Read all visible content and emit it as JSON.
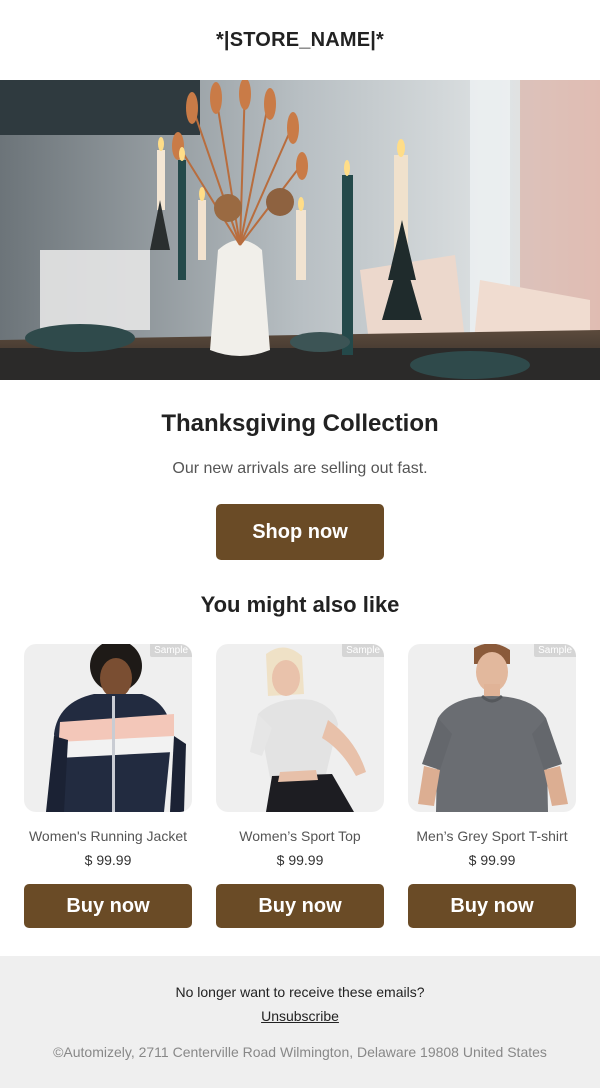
{
  "header": {
    "store_name": "*|STORE_NAME|*"
  },
  "hero": {
    "image": "thanksgiving-table-image",
    "title": "Thanksgiving Collection",
    "subtitle": "Our new arrivals are selling out fast.",
    "cta_label": "Shop now"
  },
  "recommendations": {
    "title": "You might also like",
    "sample_badge": "Sample",
    "buy_label": "Buy now",
    "products": [
      {
        "name": "Women's Running Jacket",
        "price": "$ 99.99",
        "image": "running-jacket-image"
      },
      {
        "name": "Women’s Sport Top",
        "price": "$ 99.99",
        "image": "sport-top-image"
      },
      {
        "name": "Men’s Grey Sport T-shirt",
        "price": "$ 99.99",
        "image": "grey-tshirt-image"
      }
    ]
  },
  "footer": {
    "question": "No longer want to receive these emails?",
    "unsubscribe": "Unsubscribe",
    "address": "©Automizely, 2711 Centerville Road Wilmington, Delaware 19808 United States"
  },
  "colors": {
    "accent": "#6a4b26",
    "footer_bg": "#efefef",
    "thumb_bg": "#efefef"
  }
}
